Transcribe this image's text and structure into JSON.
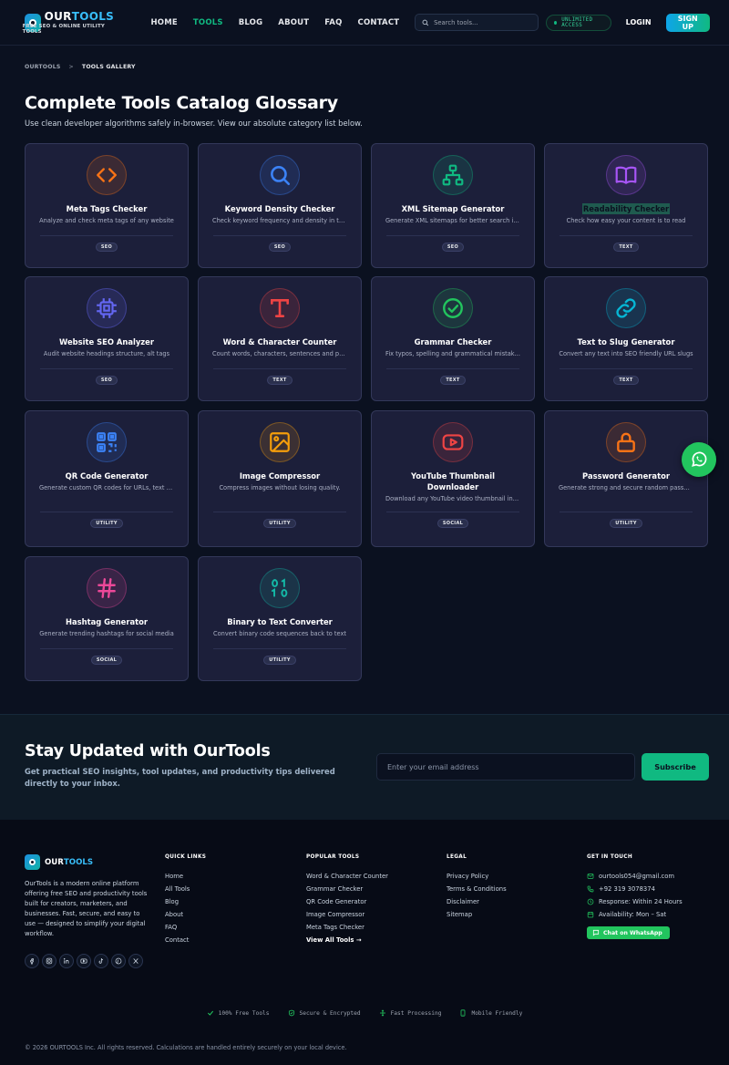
{
  "brand": {
    "name_part1": "OUR",
    "name_part2": "TOOLS",
    "tagline": "FREE SEO & ONLINE UTILITY TOOLS"
  },
  "nav": {
    "items": [
      {
        "label": "HOME",
        "active": false
      },
      {
        "label": "TOOLS",
        "active": true
      },
      {
        "label": "BLOG",
        "active": false
      },
      {
        "label": "ABOUT",
        "active": false
      },
      {
        "label": "FAQ",
        "active": false
      },
      {
        "label": "CONTACT",
        "active": false
      }
    ],
    "search_placeholder": "Search tools...",
    "access_badge": "UNLIMITED ACCESS",
    "login": "LOGIN",
    "signup": "SIGN UP"
  },
  "breadcrumb": {
    "root": "OURTOOLS",
    "separator": ">",
    "current": "TOOLS GALLERY"
  },
  "page": {
    "title": "Complete Tools Catalog Glossary",
    "subtitle": "Use clean developer algorithms safely in-browser. View our absolute category list below."
  },
  "tools": [
    {
      "title": "Meta Tags Checker",
      "desc": "Analyze and check meta tags of any website",
      "badge": "SEO",
      "icon": "code-icon",
      "color": "#f97316"
    },
    {
      "title": "Keyword Density Checker",
      "desc": "Check keyword frequency and density in text",
      "badge": "SEO",
      "icon": "search-icon",
      "color": "#3b82f6"
    },
    {
      "title": "XML Sitemap Generator",
      "desc": "Generate XML sitemaps for better search indexing",
      "badge": "SEO",
      "icon": "sitemap-icon",
      "color": "#10b981"
    },
    {
      "title": "Readability Checker",
      "desc": "Check how easy your content is to read",
      "badge": "TEXT",
      "icon": "book-icon",
      "color": "#a855f7"
    },
    {
      "title": "Website SEO Analyzer",
      "desc": "Audit website headings structure, alt tags",
      "badge": "SEO",
      "icon": "chip-icon",
      "color": "#6366f1"
    },
    {
      "title": "Word & Character Counter",
      "desc": "Count words, characters, sentences and paragraphs",
      "badge": "TEXT",
      "icon": "text-t-icon",
      "color": "#ef4444"
    },
    {
      "title": "Grammar Checker",
      "desc": "Fix typos, spelling and grammatical mistakes",
      "badge": "TEXT",
      "icon": "check-circle-icon",
      "color": "#22c55e"
    },
    {
      "title": "Text to Slug Generator",
      "desc": "Convert any text into SEO friendly URL slugs",
      "badge": "TEXT",
      "icon": "link-icon",
      "color": "#06b6d4"
    },
    {
      "title": "QR Code Generator",
      "desc": "Generate custom QR codes for URLs, text and more",
      "badge": "UTILITY",
      "icon": "qr-code-icon",
      "color": "#3b82f6"
    },
    {
      "title": "Image Compressor",
      "desc": "Compress images without losing quality.",
      "badge": "UTILITY",
      "icon": "image-icon",
      "color": "#f59e0b"
    },
    {
      "title": "YouTube Thumbnail Downloader",
      "desc": "Download any YouTube video thumbnail in HD",
      "badge": "SOCIAL",
      "icon": "youtube-icon",
      "color": "#ef4444"
    },
    {
      "title": "Password Generator",
      "desc": "Generate strong and secure random passwords",
      "badge": "UTILITY",
      "icon": "lock-icon",
      "color": "#f97316"
    },
    {
      "title": "Hashtag Generator",
      "desc": "Generate trending hashtags for social media",
      "badge": "SOCIAL",
      "icon": "hashtag-icon",
      "color": "#ec4899"
    },
    {
      "title": "Binary to Text Converter",
      "desc": "Convert binary code sequences back to text",
      "badge": "UTILITY",
      "icon": "binary-icon",
      "color": "#14b8a6"
    }
  ],
  "newsletter": {
    "title": "Stay Updated with OurTools",
    "subtitle": "Get practical SEO insights, tool updates, and productivity tips delivered directly to your inbox.",
    "placeholder": "Enter your email address",
    "button": "Subscribe"
  },
  "footer": {
    "about": "OurTools is a modern online platform offering free SEO and productivity tools built for creators, marketers, and businesses. Fast, secure, and easy to use — designed to simplify your digital workflow.",
    "socials": [
      "facebook-icon",
      "instagram-icon",
      "linkedin-icon",
      "youtube-icon",
      "tiktok-icon",
      "pinterest-icon",
      "x-icon"
    ],
    "quick_links": {
      "heading": "QUICK LINKS",
      "items": [
        "Home",
        "All Tools",
        "Blog",
        "About",
        "FAQ",
        "Contact"
      ]
    },
    "popular_tools": {
      "heading": "POPULAR TOOLS",
      "items": [
        "Word & Character Counter",
        "Grammar Checker",
        "QR Code Generator",
        "Image Compressor",
        "Meta Tags Checker"
      ],
      "view_all": "View All Tools →"
    },
    "legal": {
      "heading": "LEGAL",
      "items": [
        "Privacy Policy",
        "Terms & Conditions",
        "Disclaimer",
        "Sitemap"
      ]
    },
    "contact": {
      "heading": "GET IN TOUCH",
      "email": "ourtools054@gmail.com",
      "phone": "+92 319 3078374",
      "response": "Response: Within 24 Hours",
      "availability": "Availability: Mon – Sat",
      "whatsapp_button": "Chat on WhatsApp"
    },
    "features": [
      "100% Free Tools",
      "Secure & Encrypted",
      "Fast Processing",
      "Mobile Friendly"
    ],
    "copyright": "© 2026 OURTOOLS Inc. All rights reserved. Calculations are handled entirely securely on your local device."
  },
  "colors": {
    "accent": "#10b981",
    "brand_blue": "#38bdf8",
    "whatsapp": "#22c55e",
    "card_bg": "#1c1f3a"
  }
}
